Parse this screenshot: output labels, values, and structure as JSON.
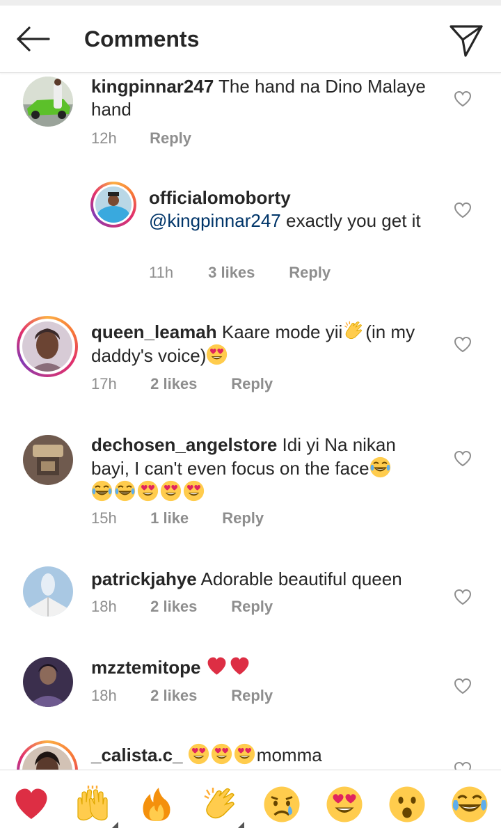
{
  "header": {
    "title": "Comments",
    "back_icon": "arrow-left-icon",
    "send_icon": "paper-plane-icon"
  },
  "comments": [
    {
      "username": "kingpinnar247",
      "text": "The hand na Dino Malaye hand",
      "time": "12h",
      "likes": "",
      "reply": "Reply"
    },
    {
      "username": "officialomoborty",
      "mention": "@kingpinnar247",
      "text": "exactly you get it",
      "time": "11h",
      "likes": "3 likes",
      "reply": "Reply"
    },
    {
      "username": "queen_leamah",
      "text": "Kaare mode yii",
      "text2": "(in my daddy's voice)",
      "time": "17h",
      "likes": "2 likes",
      "reply": "Reply"
    },
    {
      "username": "dechosen_angelstore",
      "text": "Idi yi Na nikan bayi, I can't even focus on the face",
      "time": "15h",
      "likes": "1 like",
      "reply": "Reply"
    },
    {
      "username": "patrickjahye",
      "text": "Adorable beautiful queen",
      "time": "18h",
      "likes": "2 likes",
      "reply": "Reply"
    },
    {
      "username": "mzztemitope",
      "text": "",
      "time": "18h",
      "likes": "2 likes",
      "reply": "Reply"
    },
    {
      "username": "_calista.c_",
      "text": "momma",
      "time": "",
      "likes": "",
      "reply": ""
    }
  ],
  "emoji_bar": [
    "red-heart",
    "raising-hands",
    "fire",
    "clapping-hands",
    "crying-face",
    "heart-eyes",
    "surprised-face",
    "tears-of-joy"
  ],
  "colors": {
    "mention": "#003569",
    "muted": "#8e8e8e",
    "text": "#262626",
    "heart_red": "#dd2e44"
  }
}
